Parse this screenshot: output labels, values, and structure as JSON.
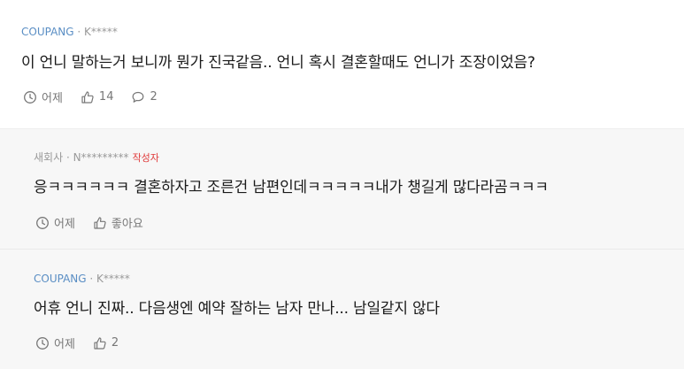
{
  "comments": [
    {
      "brand": "COUPANG",
      "author": "K*****",
      "separator": " · ",
      "author_tag": "",
      "text": "이 언니 말하는거 보니까 뭔가 진국같음.. 언니 혹시 결혼할때도 언니가 조장이었음?",
      "time": "어제",
      "likes": "14",
      "replies": "2"
    },
    {
      "brand": "새회사",
      "author": "N*********",
      "separator": " · ",
      "author_tag": "작성자",
      "text": "응ㅋㅋㅋㅋㅋㅋ 결혼하자고 조른건 남편인데ㅋㅋㅋㅋㅋ내가 챙길게 많다라곰ㅋㅋㅋ",
      "time": "어제",
      "likes": "좋아요"
    },
    {
      "brand": "COUPANG",
      "author": "K*****",
      "separator": " · ",
      "author_tag": "",
      "text": "어휴 언니 진짜.. 다음생엔 예약 잘하는 남자 만나... 남일같지 않다",
      "time": "어제",
      "likes": "2"
    }
  ],
  "colors": {
    "brand_blue": "#5a8ec4",
    "author_tag_red": "#e03b3b",
    "reply_background": "#f7f7f7"
  },
  "icons": {
    "time": "clock-icon",
    "like": "thumbs-up-icon",
    "reply": "speech-bubble-icon"
  }
}
